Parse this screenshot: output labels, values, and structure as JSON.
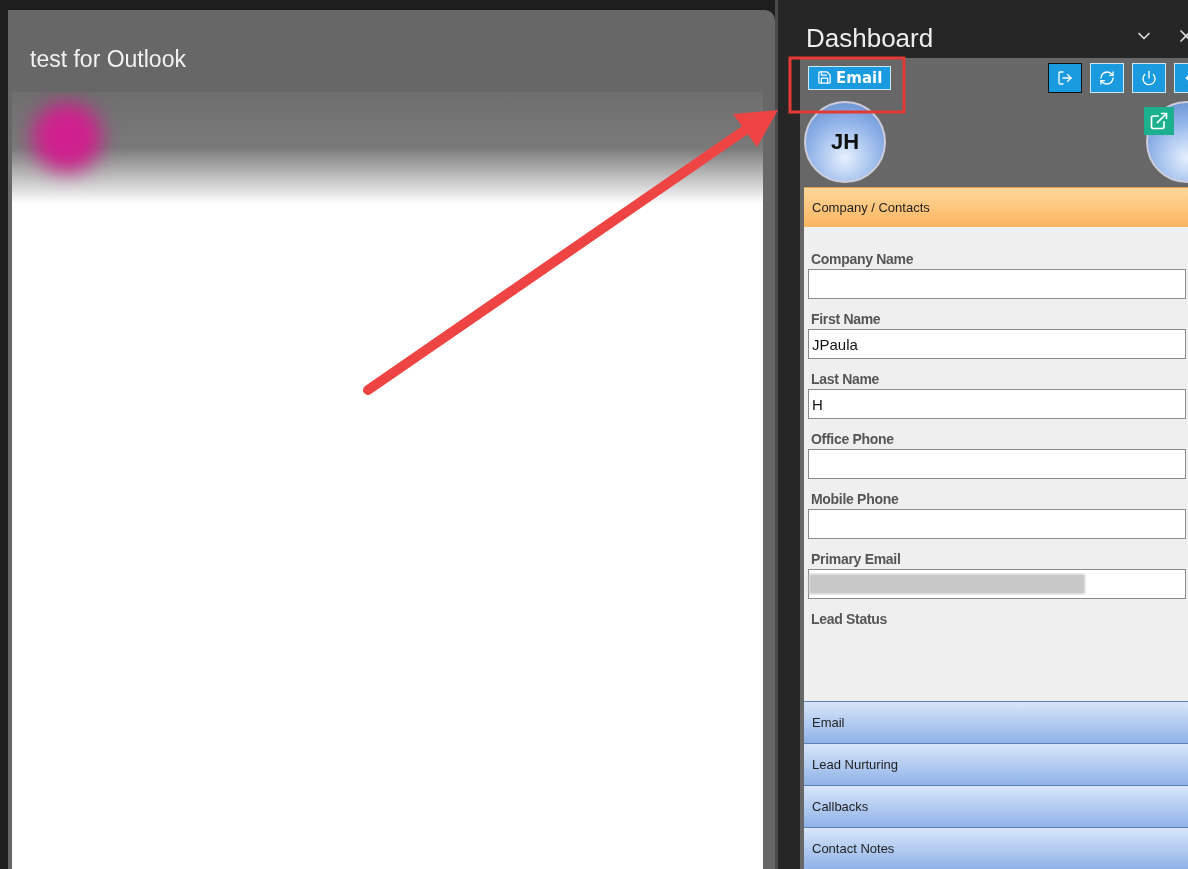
{
  "mail_window": {
    "title": "test for Outlook"
  },
  "dashboard": {
    "title": "Dashboard",
    "email_button": {
      "label": "Email"
    },
    "avatar": {
      "initials": "JH"
    },
    "fields": [
      {
        "label": "Company Name",
        "kind": "input"
      },
      {
        "label": "First Name",
        "kind": "input",
        "value": "JPaula"
      },
      {
        "label": "Last Name",
        "kind": "input",
        "value": "H"
      },
      {
        "label": "Office Phone",
        "kind": "input"
      },
      {
        "label": "Mobile Phone",
        "kind": "input"
      },
      {
        "label": "Primary Email",
        "kind": "redacted"
      },
      {
        "label": "Lead Status",
        "kind": "heading"
      }
    ],
    "sections": [
      {
        "label": "Company / Contacts",
        "expanded": true
      },
      {
        "label": "Email",
        "expanded": false
      },
      {
        "label": "Lead Nurturing",
        "expanded": false
      },
      {
        "label": "Callbacks",
        "expanded": false
      },
      {
        "label": "Contact Notes",
        "expanded": false
      }
    ]
  }
}
